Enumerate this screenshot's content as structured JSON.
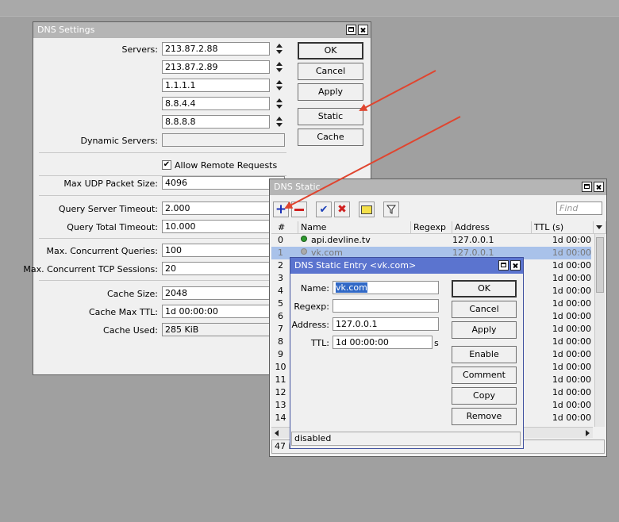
{
  "dns_settings": {
    "title": "DNS Settings",
    "servers_label": "Servers:",
    "servers": [
      "213.87.2.88",
      "213.87.2.89",
      "1.1.1.1",
      "8.8.4.4",
      "8.8.8.8"
    ],
    "dynamic_servers_label": "Dynamic Servers:",
    "dynamic_servers_value": "",
    "allow_remote_label": "Allow Remote Requests",
    "allow_remote_checked": true,
    "max_udp_label": "Max UDP Packet Size:",
    "max_udp_value": "4096",
    "query_server_timeout_label": "Query Server Timeout:",
    "query_server_timeout_value": "2.000",
    "query_total_timeout_label": "Query Total Timeout:",
    "query_total_timeout_value": "10.000",
    "max_concurrent_queries_label": "Max. Concurrent Queries:",
    "max_concurrent_queries_value": "100",
    "max_concurrent_tcp_label": "Max. Concurrent TCP Sessions:",
    "max_concurrent_tcp_value": "20",
    "cache_size_label": "Cache Size:",
    "cache_size_value": "2048",
    "cache_max_ttl_label": "Cache Max TTL:",
    "cache_max_ttl_value": "1d 00:00:00",
    "cache_used_label": "Cache Used:",
    "cache_used_value": "285 KiB",
    "buttons": {
      "ok": "OK",
      "cancel": "Cancel",
      "apply": "Apply",
      "static": "Static",
      "cache": "Cache"
    }
  },
  "dns_static": {
    "title": "DNS Static",
    "find_placeholder": "Find",
    "columns": [
      "#",
      "Name",
      "Regexp",
      "Address",
      "TTL (s)"
    ],
    "rows": [
      {
        "num": "0",
        "name": "api.devline.tv",
        "address": "127.0.0.1",
        "ttl": "1d 00:00"
      },
      {
        "num": "1",
        "name": "vk.com",
        "address": "127.0.0.1",
        "ttl": "1d 00:00"
      },
      {
        "num": "2",
        "name": "",
        "address": "",
        "ttl": "1d 00:00"
      },
      {
        "num": "3",
        "name": "",
        "address": "",
        "ttl": "1d 00:00"
      },
      {
        "num": "4",
        "name": "",
        "address": "",
        "ttl": "1d 00:00"
      },
      {
        "num": "5",
        "name": "",
        "address": "",
        "ttl": "1d 00:00"
      },
      {
        "num": "6",
        "name": "",
        "address": "",
        "ttl": "1d 00:00"
      },
      {
        "num": "7",
        "name": "",
        "address": "",
        "ttl": "1d 00:00"
      },
      {
        "num": "8",
        "name": "",
        "address": "",
        "ttl": "1d 00:00"
      },
      {
        "num": "9",
        "name": "",
        "address": "",
        "ttl": "1d 00:00"
      },
      {
        "num": "10",
        "name": "",
        "address": "",
        "ttl": "1d 00:00"
      },
      {
        "num": "11",
        "name": "",
        "address": "",
        "ttl": "1d 00:00"
      },
      {
        "num": "12",
        "name": "",
        "address": "",
        "ttl": "1d 00:00"
      },
      {
        "num": "13",
        "name": "",
        "address": "",
        "ttl": "1d 00:00"
      },
      {
        "num": "14",
        "name": "",
        "address": "",
        "ttl": "1d 00:00"
      }
    ],
    "status_count": "47 it"
  },
  "dns_entry": {
    "title": "DNS Static Entry <vk.com>",
    "name_label": "Name:",
    "name_value": "vk.com",
    "regexp_label": "Regexp:",
    "regexp_value": "",
    "address_label": "Address:",
    "address_value": "127.0.0.1",
    "ttl_label": "TTL:",
    "ttl_value": "1d 00:00:00",
    "ttl_unit": "s",
    "buttons": {
      "ok": "OK",
      "cancel": "Cancel",
      "apply": "Apply",
      "enable": "Enable",
      "comment": "Comment",
      "copy": "Copy",
      "remove": "Remove"
    },
    "status": "disabled"
  },
  "colors": {
    "active_title": "#5b74cf",
    "inactive_title": "#b5b5b5",
    "annotation_arrow": "#e0452f",
    "selected_row": "#a9c2ea"
  }
}
